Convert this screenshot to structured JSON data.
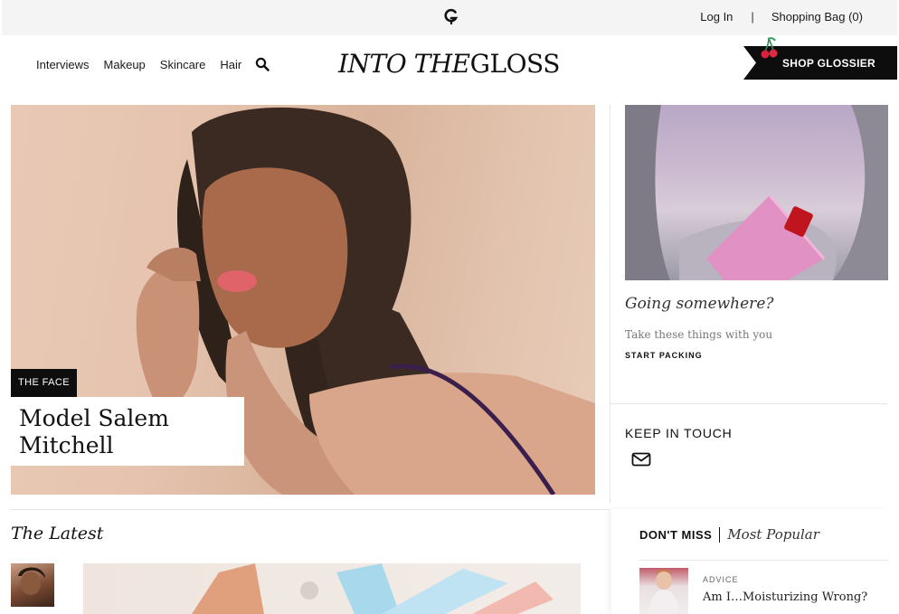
{
  "topbar": {
    "logo_icon": "glossier-g-icon",
    "login_label": "Log In",
    "separator": "|",
    "bag_label": "Shopping Bag (0)"
  },
  "nav": {
    "items": [
      "Interviews",
      "Makeup",
      "Skincare",
      "Hair"
    ],
    "search_icon": "search-icon"
  },
  "logo": {
    "part1": "INTO THE",
    "part2": "GLOSS"
  },
  "shop": {
    "label": "SHOP GLOSSIER",
    "icon": "cherry-icon"
  },
  "hero": {
    "tag": "THE FACE",
    "title": "Model Salem Mitchell"
  },
  "promo": {
    "title": "Going somewhere?",
    "subtitle": "Take these things with you",
    "cta": "START PACKING"
  },
  "keep_in_touch": {
    "title": "KEEP IN TOUCH",
    "icon": "mail-icon"
  },
  "latest": {
    "title": "The Latest"
  },
  "dont_miss": {
    "tab_active": "DON'T MISS",
    "tab_other": "Most Popular",
    "item": {
      "category": "ADVICE",
      "title": "Am I…Moisturizing Wrong?"
    }
  },
  "colors": {
    "black": "#0d0d0d",
    "topbar_bg": "#f4f4f4",
    "divider": "#e6e6e6"
  }
}
